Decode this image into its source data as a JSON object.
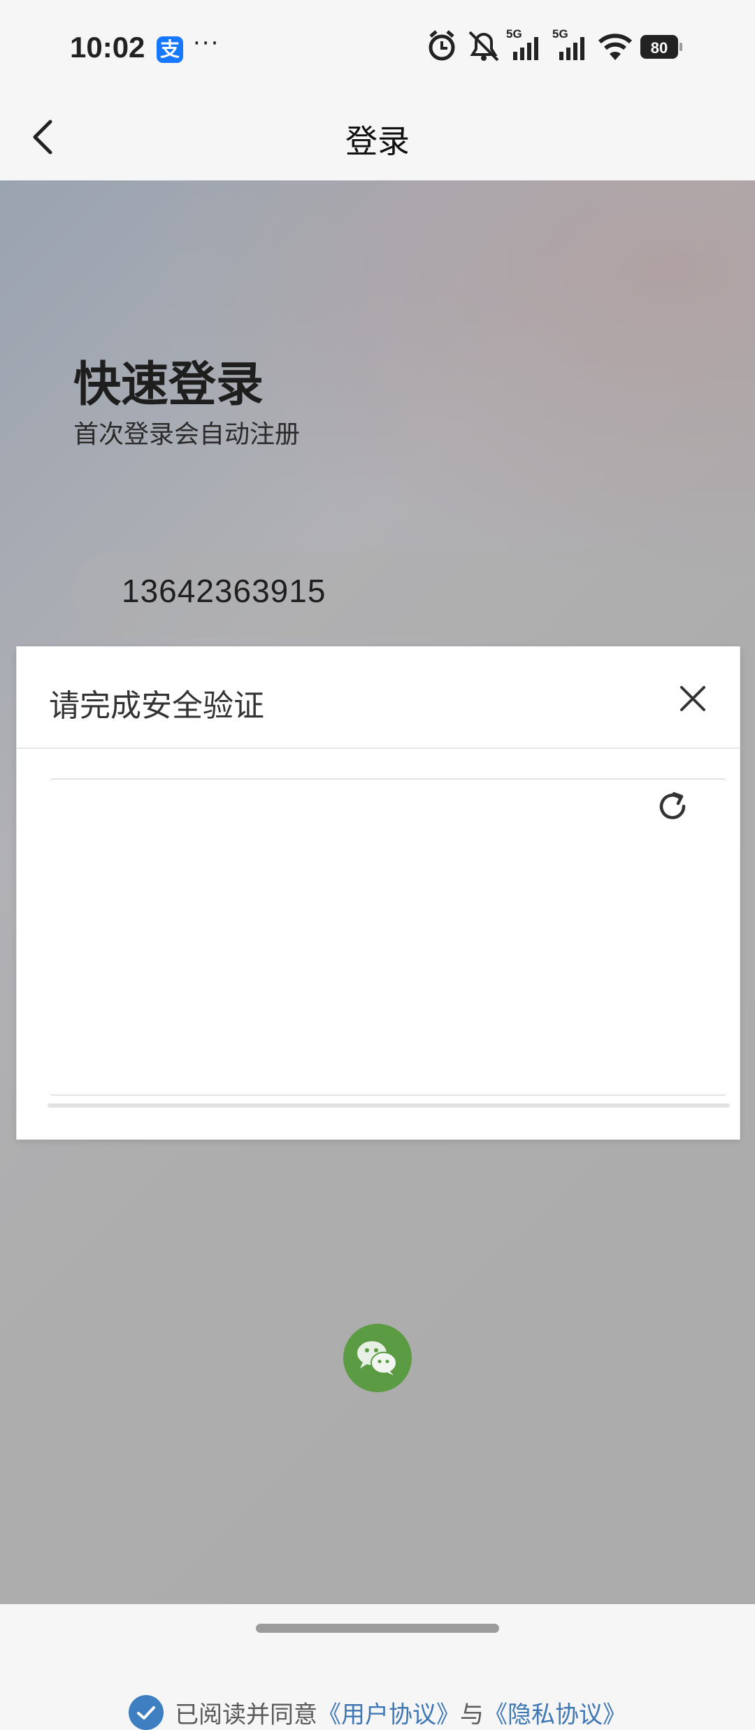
{
  "status": {
    "time": "10:02",
    "app_icon": "alipay-icon",
    "more": "···",
    "icons": [
      "alarm-icon",
      "mute-icon",
      "signal-5g-icon",
      "signal-5g-icon",
      "wifi-icon",
      "battery-icon"
    ],
    "battery": "80",
    "net1": "5G",
    "net2": "5G"
  },
  "nav": {
    "title": "登录",
    "back_icon": "back-arrow-icon"
  },
  "login": {
    "headline": "快速登录",
    "subline": "首次登录会自动注册",
    "phone_value": "13642363915"
  },
  "dialog": {
    "title": "请完成安全验证",
    "close_icon": "close-icon",
    "refresh_icon": "refresh-icon"
  },
  "social": {
    "wechat_icon": "wechat-icon"
  },
  "agreement": {
    "prefix": "已阅读并同意",
    "user_link": "《用户协议》",
    "and": "与",
    "privacy_link": "《隐私协议》",
    "checked": true
  },
  "colors": {
    "link": "#3f77b5",
    "check": "#3e7fc1",
    "wechat": "#5a9b43"
  }
}
